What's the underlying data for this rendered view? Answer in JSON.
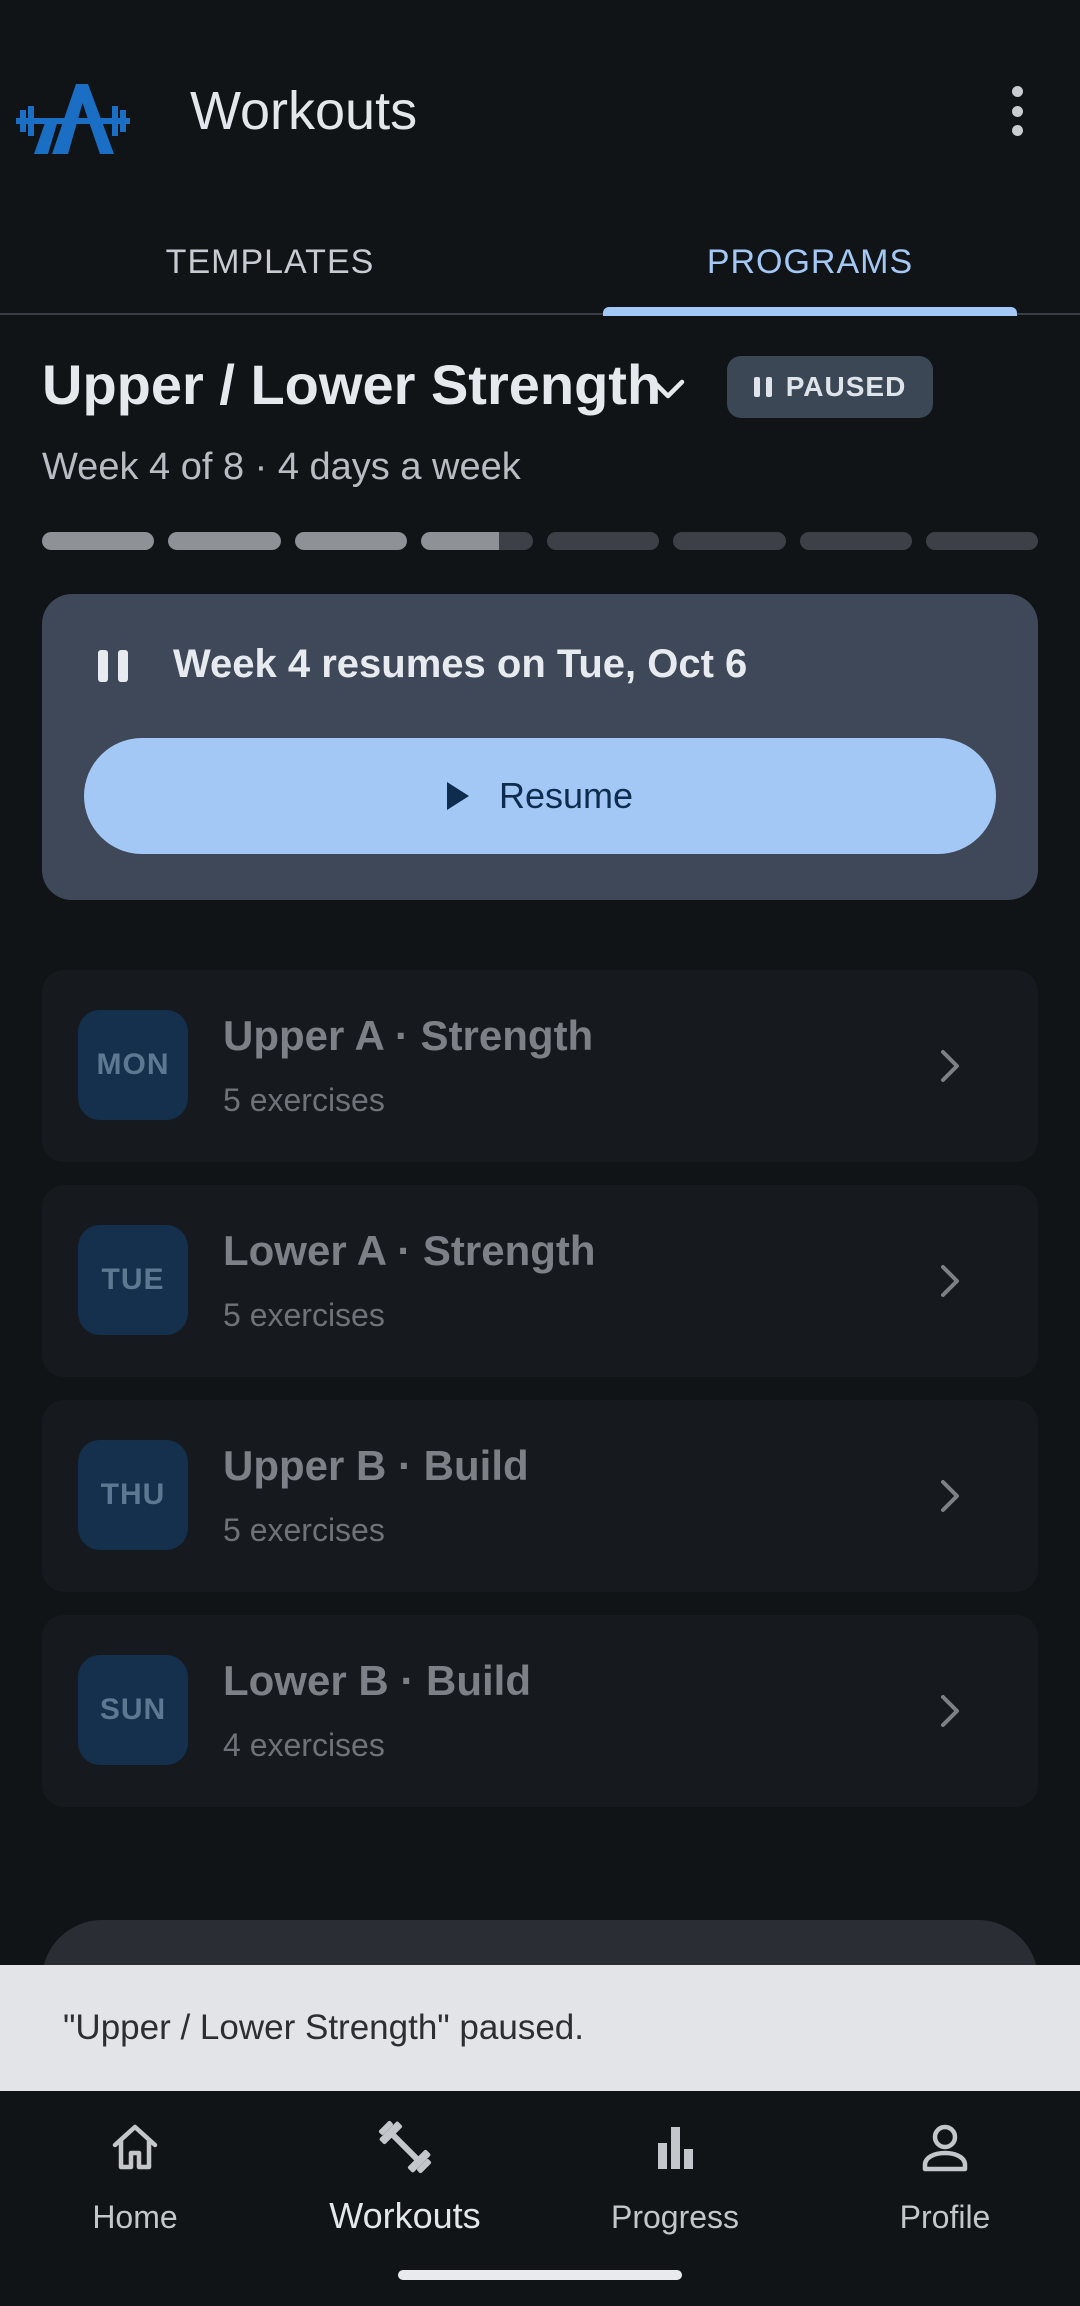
{
  "app": {
    "title": "Workouts"
  },
  "tabs": [
    {
      "label": "TEMPLATES",
      "active": false
    },
    {
      "label": "PROGRAMS",
      "active": true
    }
  ],
  "program": {
    "title": "Upper / Lower Strength",
    "status": "PAUSED",
    "subtitle": "Week 4 of 8 · 4 days a week",
    "progress": {
      "total_weeks": 8,
      "current_week": 4,
      "current_week_fraction": 0.7
    }
  },
  "paused_card": {
    "message": "Week 4 resumes on Tue, Oct 6",
    "resume_label": "Resume"
  },
  "workouts": [
    {
      "day": "MON",
      "title": "Upper A · Strength",
      "subtitle": "5 exercises"
    },
    {
      "day": "TUE",
      "title": "Lower A · Strength",
      "subtitle": "5 exercises"
    },
    {
      "day": "THU",
      "title": "Upper B · Build",
      "subtitle": "5 exercises"
    },
    {
      "day": "SUN",
      "title": "Lower B · Build",
      "subtitle": "4 exercises"
    }
  ],
  "snackbar": {
    "message": "\"Upper / Lower Strength\" paused."
  },
  "nav": [
    {
      "label": "Home",
      "icon": "home-icon"
    },
    {
      "label": "Workouts",
      "icon": "dumbbell-icon",
      "active": true
    },
    {
      "label": "Progress",
      "icon": "bar-chart-icon"
    },
    {
      "label": "Profile",
      "icon": "person-icon"
    }
  ],
  "colors": {
    "accent": "#a3c8f5",
    "background": "#111417",
    "card": "#3e4858",
    "logo_blue": "#1a6fc4"
  }
}
